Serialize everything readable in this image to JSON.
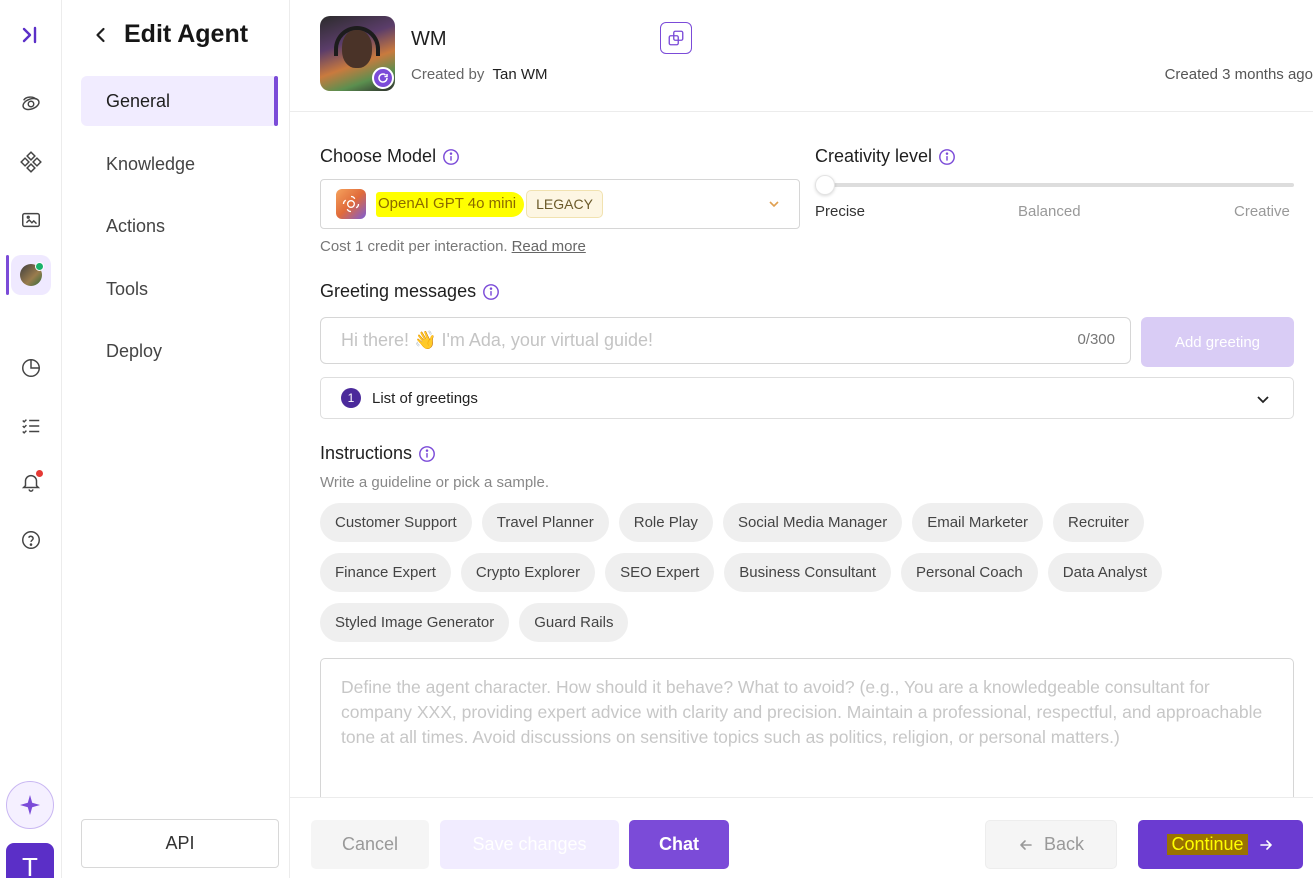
{
  "nav": {
    "title": "Edit Agent",
    "items": [
      {
        "label": "General"
      },
      {
        "label": "Knowledge"
      },
      {
        "label": "Actions"
      },
      {
        "label": "Tools"
      },
      {
        "label": "Deploy"
      }
    ],
    "api_label": "API"
  },
  "rail": {
    "user_initial": "T",
    "accent": "#7b4bd8"
  },
  "header": {
    "agent_name": "WM",
    "created_by_label": "Created by",
    "creator": "Tan WM",
    "created_ago": "Created 3 months ago"
  },
  "model": {
    "label": "Choose Model",
    "selected": "OpenAI GPT 4o mini",
    "tag": "LEGACY",
    "cost_text": "Cost 1 credit per interaction.",
    "read_more": "Read more"
  },
  "creativity": {
    "label": "Creativity level",
    "level": 0,
    "stops": [
      "Precise",
      "Balanced",
      "Creative"
    ]
  },
  "greetings": {
    "label": "Greeting messages",
    "placeholder": "Hi there! 👋 I'm Ada, your virtual guide!",
    "counter": "0/300",
    "add_button": "Add greeting",
    "list_count": "1",
    "list_label": "List of greetings"
  },
  "instructions": {
    "label": "Instructions",
    "subtitle": "Write a guideline or pick a sample.",
    "samples_rows": [
      [
        "Customer Support",
        "Travel Planner",
        "Role Play",
        "Social Media Manager",
        "Email Marketer",
        "Recruiter"
      ],
      [
        "Finance Expert",
        "Crypto Explorer",
        "SEO Expert",
        "Business Consultant",
        "Personal Coach",
        "Data Analyst"
      ],
      [
        "Styled Image Generator",
        "Guard Rails"
      ]
    ],
    "placeholder": "Define the agent character. How should it behave? What to avoid? (e.g., You are a knowledgeable consultant for company XXX, providing expert advice with clarity and precision. Maintain a professional, respectful, and approachable tone at all times. Avoid discussions on sensitive topics such as politics, religion, or personal matters.)"
  },
  "footer": {
    "cancel": "Cancel",
    "save": "Save changes",
    "chat": "Chat",
    "back": "Back",
    "continue": "Continue"
  }
}
